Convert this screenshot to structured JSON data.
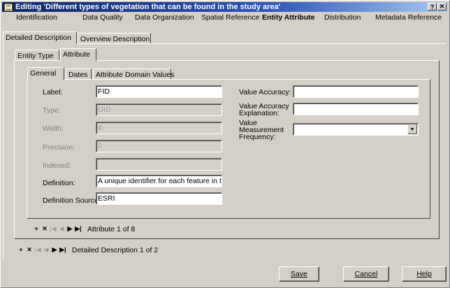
{
  "window": {
    "title": "Editing 'Different types of vegetation that can be found in the study area'",
    "help_glyph": "?",
    "close_glyph": "✕"
  },
  "menu": [
    {
      "label": "Identification",
      "active": false
    },
    {
      "label": "Data Quality",
      "active": false
    },
    {
      "label": "Data Organization",
      "active": false
    },
    {
      "label": "Spatial Reference",
      "active": false
    },
    {
      "label": "Entity Attribute",
      "active": true
    },
    {
      "label": "Distribution",
      "active": false
    },
    {
      "label": "Metadata Reference",
      "active": false
    }
  ],
  "outer_tabs": [
    "Detailed Description",
    "Overview Description"
  ],
  "middle_tabs": [
    "Entity Type",
    "Attribute"
  ],
  "inner_tabs": [
    "General",
    "Dates",
    "Attribute Domain Values"
  ],
  "form": {
    "label": {
      "label": "Label:",
      "value": "FID"
    },
    "type": {
      "label": "Type:",
      "value": "OID"
    },
    "width": {
      "label": "Width:",
      "value": "4"
    },
    "precision": {
      "label": "Precision:",
      "value": "0"
    },
    "indexed": {
      "label": "Indexed:",
      "value": ""
    },
    "definition": {
      "label": "Definition:",
      "value": "A unique identifier for each feature in the"
    },
    "definition_source": {
      "label": "Definition Source:",
      "value": "ESRI"
    },
    "value_accuracy": {
      "label": "Value Accuracy:",
      "value": ""
    },
    "value_accuracy_explanation": {
      "label_line1": "Value Accuracy",
      "label_line2": "Explanation:",
      "value": ""
    },
    "value_measurement_frequency": {
      "label_line1": "Value",
      "label_line2": "Measurement",
      "label_line3": "Frequency:",
      "value": ""
    }
  },
  "nav": {
    "add": "+",
    "delete": "✕",
    "first": "|◀",
    "prev": "◀",
    "next": "▶",
    "last": "▶|",
    "attribute_status": "Attribute 1 of 8",
    "description_status": "Detailed Description 1 of 2"
  },
  "buttons": {
    "save": "Save",
    "cancel": "Cancel",
    "help": "Help"
  },
  "colors": {
    "title_start": "#0a246a",
    "title_end": "#a6caf0",
    "face": "#d4d0c8"
  }
}
